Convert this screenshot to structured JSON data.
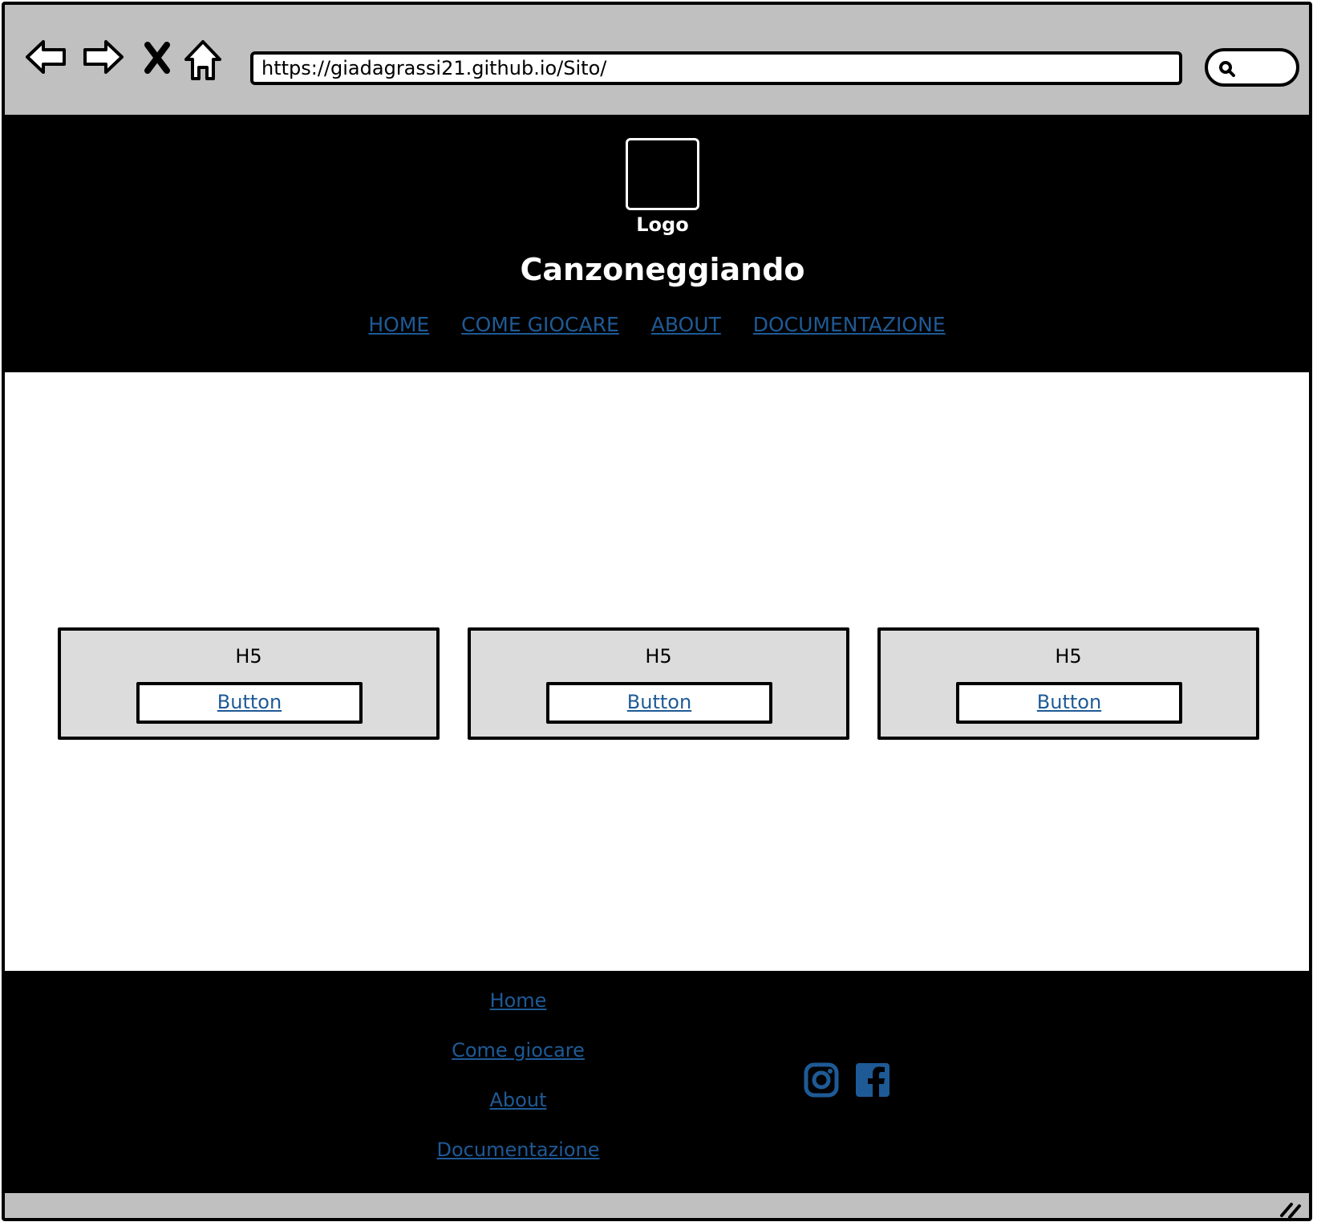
{
  "browser": {
    "url": "https://giadagrassi21.github.io/Sito/"
  },
  "header": {
    "logo_label": "Logo",
    "site_title": "Canzoneggiando",
    "nav": [
      {
        "label": "HOME"
      },
      {
        "label": "COME GIOCARE"
      },
      {
        "label": "ABOUT"
      },
      {
        "label": "DOCUMENTAZIONE"
      }
    ]
  },
  "cards": [
    {
      "title": "H5",
      "button_label": "Button"
    },
    {
      "title": "H5",
      "button_label": "Button"
    },
    {
      "title": "H5",
      "button_label": "Button"
    }
  ],
  "footer": {
    "links": [
      {
        "label": "Home"
      },
      {
        "label": "Come giocare"
      },
      {
        "label": "About"
      },
      {
        "label": "Documentazione"
      }
    ],
    "social": [
      "instagram-icon",
      "facebook-icon"
    ]
  },
  "colors": {
    "link": "#1e5a96",
    "chrome": "#c0c0c0",
    "card": "#dcdcdc"
  }
}
